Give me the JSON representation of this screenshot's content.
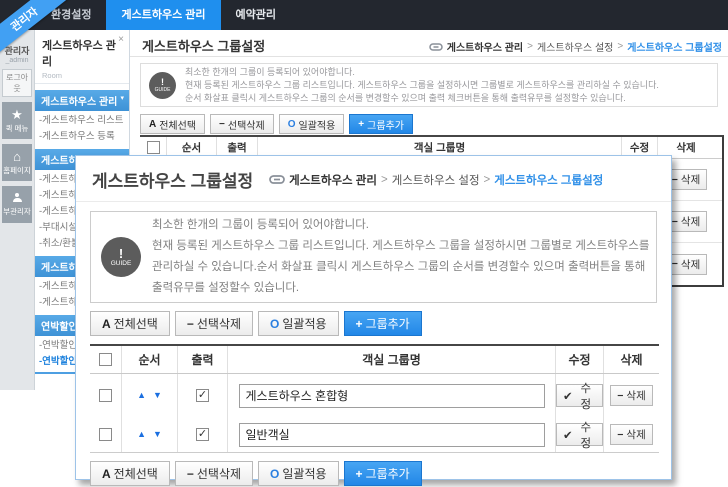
{
  "ribbon": {
    "label": "관리자"
  },
  "topbar": {
    "tabs": [
      {
        "label": "환경설정"
      },
      {
        "label": "게스트하우스 관리"
      },
      {
        "label": "예약관리"
      }
    ]
  },
  "rail": {
    "user": "관리자",
    "user_id": "_admin",
    "logout_label": "로그아웃",
    "tiles": [
      {
        "icon": "★",
        "label": "퀵 메뉴"
      },
      {
        "icon": "⌂",
        "label": "홈페이지"
      },
      {
        "icon": "",
        "label": "부관리자"
      }
    ]
  },
  "sidebar": {
    "title": "게스트하우스 관리",
    "subtitle": "Room",
    "close_glyph": "×",
    "section_arrow": "▾",
    "sections": [
      {
        "label": "게스트하우스 관리",
        "items": [
          "-게스트하우스 리스트",
          "-게스트하우스 등록"
        ]
      },
      {
        "label": "게스트하우스 설정",
        "items": [
          "-게스트하우스 그룹설정",
          "-게스트하우스 시설설정",
          "-게스트하우스 유형설정",
          "-부대시설 설정",
          "-취소/환불규정"
        ]
      },
      {
        "label": "게스트하우스",
        "items": [
          "-게스트하우스",
          "-게스트하우스"
        ]
      },
      {
        "label": "연박할인",
        "items": [
          "-연박할인",
          "-연박할인"
        ]
      }
    ]
  },
  "breadcrumb_sep": ">",
  "window": {
    "title": "게스트하우스 그룹설정",
    "breadcrumb": [
      "게스트하우스 관리",
      "게스트하우스 설정",
      "게스트하우스 그룹설정"
    ],
    "guide_icon": {
      "exclaim": "!",
      "word": "GUIDE"
    },
    "guide_lines": [
      "최소한 한개의 그룹이 등록되어 있어야합니다.",
      "현재 등록된 게스트하우스 그룹 리스트입니다. 게스트하우스 그룹을 설정하시면 그룹별로 게스트하우스를 관리하실 수 있습니다.",
      "순서 화살표 클릭시 게스트하우스 그룹의 순서를 변경할수 있으며 출력 체크버튼을 통해 출력유무를 설정할수 있습니다."
    ],
    "buttons": {
      "select_all_prefix": "A",
      "select_all": "전체선택",
      "delete_sel_prefix": "−",
      "delete_sel": "선택삭제",
      "apply_all_prefix": "O",
      "apply_all": "일괄적용",
      "add_group_prefix": "+",
      "add_group": "그룹추가"
    },
    "table": {
      "headers": [
        "순서",
        "출력",
        "객실 그룹명",
        "수정",
        "삭제"
      ],
      "delete_prefix": "−",
      "delete_label": "삭제",
      "rows": [
        {},
        {},
        {}
      ]
    }
  },
  "modal": {
    "title": "게스트하우스 그룹설정",
    "breadcrumb": [
      "게스트하우스 관리",
      "게스트하우스 설정",
      "게스트하우스 그룹설정"
    ],
    "guide_icon": {
      "exclaim": "!",
      "word": "GUIDE"
    },
    "guide_lines": [
      "최소한 한개의 그룹이 등록되어 있어야합니다.",
      "현재 등록된 게스트하우스 그룹 리스트입니다. 게스트하우스 그룹을 설정하시면 그룹별로 게스트하우스를",
      "관리하실 수 있습니다.순서 화살표 클릭시 게스트하우스 그룹의 순서를 변경할수 있으며 출력버튼을 통해",
      "출력유무를 설정할수 있습니다."
    ],
    "buttons": {
      "select_all_prefix": "A",
      "select_all": "전체선택",
      "delete_sel_prefix": "−",
      "delete_sel": "선택삭제",
      "apply_all_prefix": "O",
      "apply_all": "일괄적용",
      "add_group_prefix": "+",
      "add_group": "그룹추가"
    },
    "table": {
      "headers": [
        "순서",
        "출력",
        "객실 그룹명",
        "수정",
        "삭제"
      ],
      "up_arrow": "▲",
      "down_arrow": "▼",
      "check_glyph": "✓",
      "edit_check": "✔",
      "edit_label": "수정",
      "delete_prefix": "−",
      "delete_label": "삭제",
      "rows": [
        {
          "group_name": "게스트하우스 혼합형"
        },
        {
          "group_name": "일반객실"
        }
      ]
    }
  },
  "colors": {
    "accent_blue": "#1f8fee",
    "section_blue": "#4d9fe2",
    "dark_bar": "#23272f"
  }
}
